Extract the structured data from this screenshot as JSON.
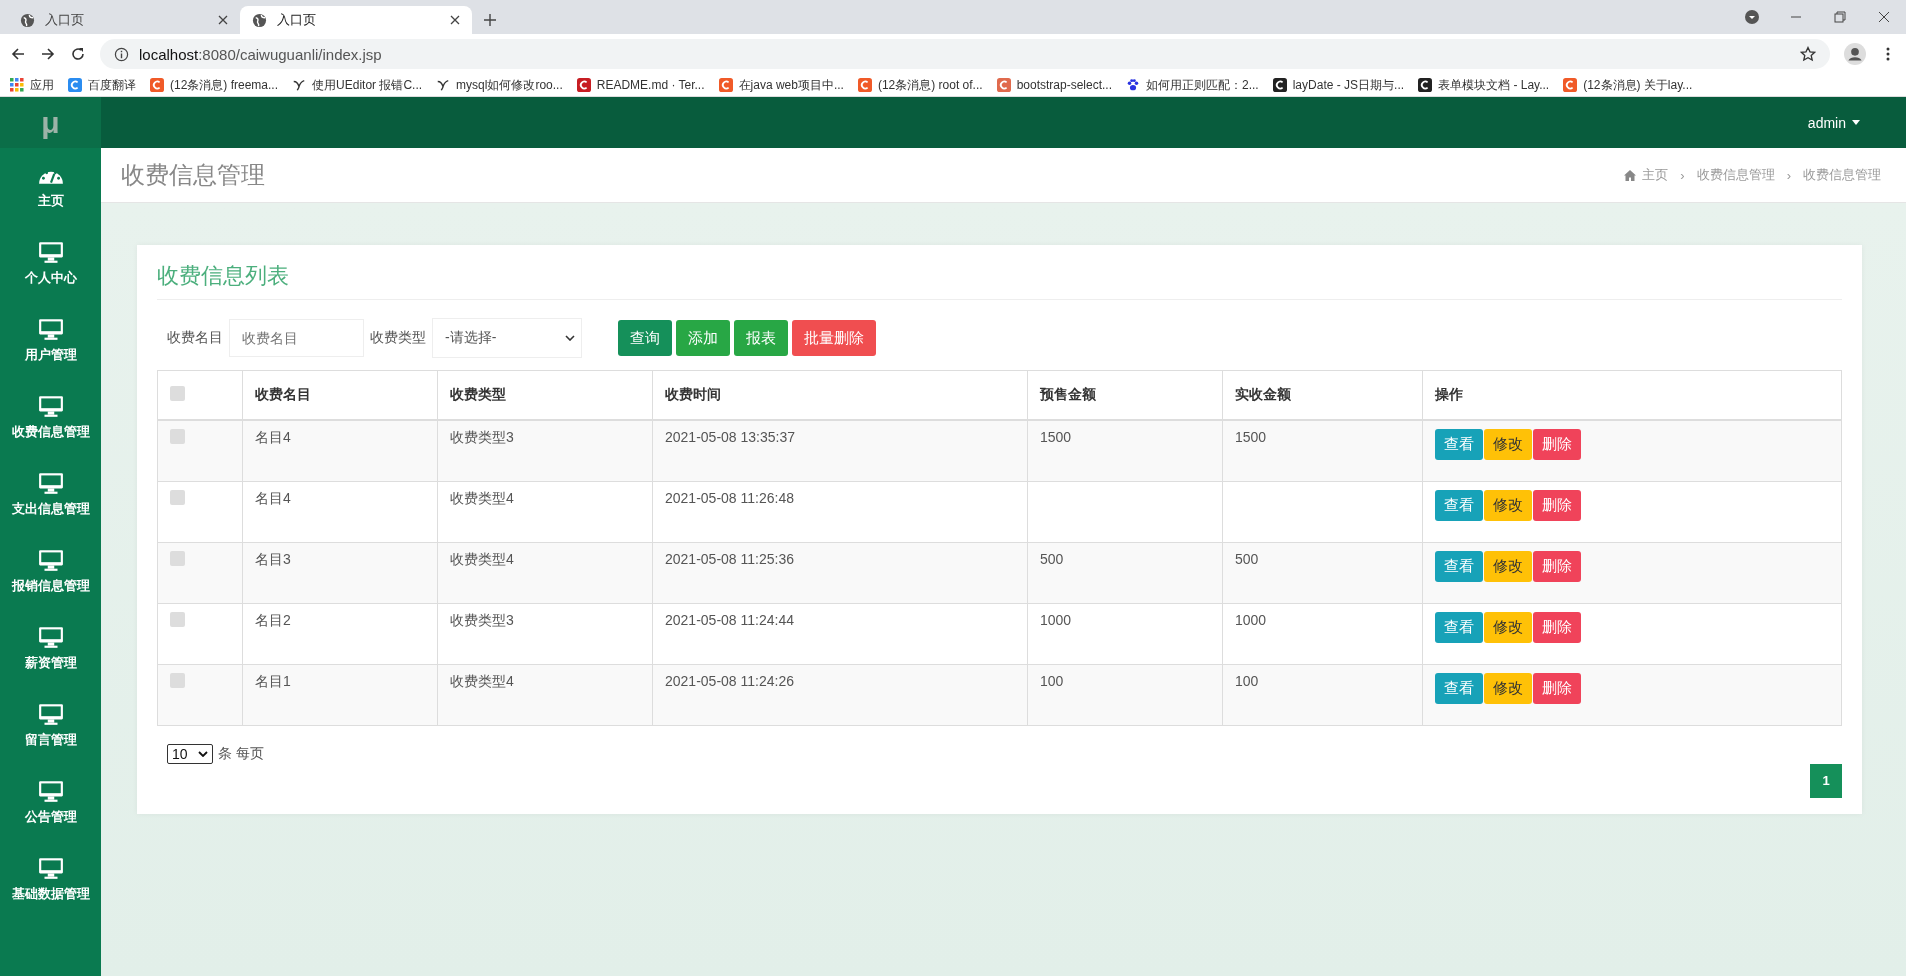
{
  "browser": {
    "tabs": [
      {
        "title": "入口页",
        "selected": false
      },
      {
        "title": "入口页",
        "selected": true
      }
    ],
    "address": {
      "host": "localhost",
      "rest": ":8080/caiwuguanli/index.jsp"
    },
    "bookmarks": [
      {
        "kind": "apps",
        "label": "应用"
      },
      {
        "kind": "translate",
        "label": "百度翻译"
      },
      {
        "kind": "csdn",
        "label": "(12条消息) freema..."
      },
      {
        "kind": "yuque",
        "label": "使用UEditor 报错C..."
      },
      {
        "kind": "yuque",
        "label": "mysql如何修改roo..."
      },
      {
        "kind": "gitee",
        "label": "README.md · Ter..."
      },
      {
        "kind": "csdn",
        "label": "在java web项目中..."
      },
      {
        "kind": "csdn",
        "label": "(12条消息) root of..."
      },
      {
        "kind": "jianshu",
        "label": "bootstrap-select..."
      },
      {
        "kind": "baidu",
        "label": "如何用正则匹配：2..."
      },
      {
        "kind": "layui",
        "label": "layDate - JS日期与..."
      },
      {
        "kind": "layui",
        "label": "表单模块文档 - Lay..."
      },
      {
        "kind": "csdn",
        "label": "(12条消息) 关于lay..."
      }
    ]
  },
  "app": {
    "logo": "μ",
    "user": "admin"
  },
  "sidebar": {
    "items": [
      {
        "kind": "dashboard",
        "label": "主页"
      },
      {
        "kind": "monitor",
        "label": "个人中心"
      },
      {
        "kind": "monitor",
        "label": "用户管理"
      },
      {
        "kind": "monitor",
        "label": "收费信息管理"
      },
      {
        "kind": "monitor",
        "label": "支出信息管理"
      },
      {
        "kind": "monitor",
        "label": "报销信息管理"
      },
      {
        "kind": "monitor",
        "label": "薪资管理"
      },
      {
        "kind": "monitor",
        "label": "留言管理"
      },
      {
        "kind": "monitor",
        "label": "公告管理"
      },
      {
        "kind": "monitor",
        "label": "基础数据管理"
      }
    ]
  },
  "page_title": "收费信息管理",
  "breadcrumb": [
    {
      "label": "主页"
    },
    {
      "separator": "›",
      "label": "收费信息管理"
    },
    {
      "separator": "›",
      "label": "收费信息管理"
    }
  ],
  "card": {
    "title": "收费信息列表",
    "filters": [
      {
        "kind": "input",
        "label": "收费名目",
        "placeholder": "收费名目"
      },
      {
        "kind": "select",
        "label": "收费类型",
        "value": "-请选择-"
      }
    ],
    "buttons": [
      {
        "kind": "search",
        "label": "查询"
      },
      {
        "kind": "add",
        "label": "添加"
      },
      {
        "kind": "report",
        "label": "报表"
      },
      {
        "kind": "delete",
        "label": "批量删除"
      }
    ]
  },
  "table": {
    "header_checked": false,
    "columns": [
      "收费名目",
      "收费类型",
      "收费时间",
      "预售金额",
      "实收金额",
      "操作"
    ],
    "rows": [
      {
        "checked": false,
        "cells": [
          "名目4",
          "收费类型3",
          "2021-05-08 13:35:37",
          "1500",
          "1500"
        ],
        "actions": [
          {
            "kind": "view",
            "label": "查看"
          },
          {
            "kind": "edit",
            "label": "修改"
          },
          {
            "kind": "delete",
            "label": "删除"
          }
        ]
      },
      {
        "checked": false,
        "cells": [
          "名目4",
          "收费类型4",
          "2021-05-08 11:26:48",
          "",
          ""
        ],
        "actions": [
          {
            "kind": "view",
            "label": "查看"
          },
          {
            "kind": "edit",
            "label": "修改"
          },
          {
            "kind": "delete",
            "label": "删除"
          }
        ]
      },
      {
        "checked": false,
        "cells": [
          "名目3",
          "收费类型4",
          "2021-05-08 11:25:36",
          "500",
          "500"
        ],
        "actions": [
          {
            "kind": "view",
            "label": "查看"
          },
          {
            "kind": "edit",
            "label": "修改"
          },
          {
            "kind": "delete",
            "label": "删除"
          }
        ]
      },
      {
        "checked": false,
        "cells": [
          "名目2",
          "收费类型3",
          "2021-05-08 11:24:44",
          "1000",
          "1000"
        ],
        "actions": [
          {
            "kind": "view",
            "label": "查看"
          },
          {
            "kind": "edit",
            "label": "修改"
          },
          {
            "kind": "delete",
            "label": "删除"
          }
        ]
      },
      {
        "checked": false,
        "cells": [
          "名目1",
          "收费类型4",
          "2021-05-08 11:24:26",
          "100",
          "100"
        ],
        "actions": [
          {
            "kind": "view",
            "label": "查看"
          },
          {
            "kind": "edit",
            "label": "修改"
          },
          {
            "kind": "delete",
            "label": "删除"
          }
        ]
      }
    ]
  },
  "page_size": {
    "value": "10",
    "suffix": "条 每页"
  },
  "pagination": [
    {
      "label": "1",
      "selected": true
    }
  ]
}
